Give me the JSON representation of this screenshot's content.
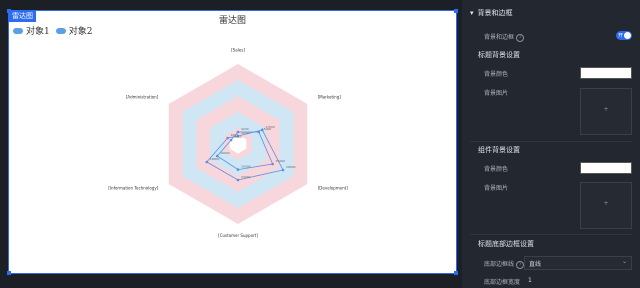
{
  "canvas": {
    "tag": "雷达图",
    "title": "雷达图",
    "legend": [
      {
        "name": "对象1",
        "color": "#5aa0e6"
      },
      {
        "name": "对象2",
        "color": "#5aa0e6"
      }
    ]
  },
  "chart_data": {
    "type": "radar",
    "indicators": [
      "Sales",
      "Marketing",
      "Development",
      "Customer Support",
      "Information Technology",
      "Administration"
    ],
    "series": [
      {
        "name": "对象1",
        "values": [
          0.1,
          0.35,
          0.65,
          0.45,
          0.45,
          0.15
        ],
        "point_labels": [
          "2000",
          "17000",
          "28000",
          "23000",
          "18000",
          "4000"
        ]
      },
      {
        "name": "对象2",
        "values": [
          0.15,
          0.3,
          0.5,
          0.32,
          0.3,
          0.1
        ],
        "point_labels": [
          "4200",
          "15000",
          "25000",
          "19000",
          "16000",
          "3000"
        ]
      }
    ],
    "colors": {
      "ring_pink": "#f7d6dc",
      "ring_blue": "#cfe6f5",
      "line": "#5b8fe0"
    }
  },
  "panel": {
    "section_title": "背景和边框",
    "bg_border_label": "背景和边框",
    "toggle_text": "开",
    "title_bg_settings": "标题背景设置",
    "bg_color_label": "背景颜色",
    "bg_image_label": "背景图片",
    "component_bg_settings": "组件背景设置",
    "comp_bg_color_label": "背景颜色",
    "comp_bg_image_label": "背景图片",
    "title_bottom_border": "标题底部边框设置",
    "bottom_border_line_label": "底部边框线",
    "bottom_border_line_value": "直线",
    "bottom_border_width_label": "底部边框宽度",
    "bottom_border_width_value": "1",
    "upload_plus": "+"
  }
}
